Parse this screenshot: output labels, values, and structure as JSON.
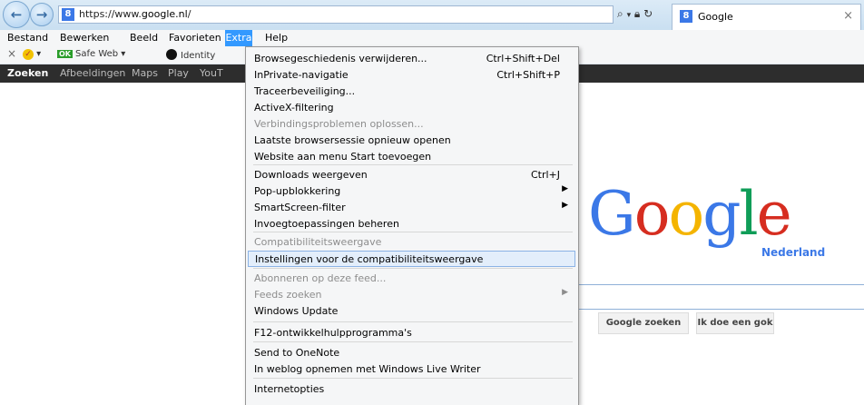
{
  "browser": {
    "url_prefix": "https://www.",
    "url_domain": "google.nl",
    "url_suffix": "/",
    "tab_title": "Google",
    "tab_close": "×"
  },
  "menubar": [
    "Bestand",
    "Bewerken",
    "Beeld",
    "Favorieten",
    "Extra",
    "Help"
  ],
  "toolbar": {
    "close": "×",
    "safe_web": "Safe Web ▾",
    "ok": "OK",
    "identity": "Identity"
  },
  "google_bar": [
    "Zoeken",
    "Afbeeldingen",
    "Maps",
    "Play",
    "YouT"
  ],
  "extra_menu": [
    {
      "label": "Browsegeschiedenis verwijderen...",
      "shortcut": "Ctrl+Shift+Del"
    },
    {
      "label": "InPrivate-navigatie",
      "shortcut": "Ctrl+Shift+P"
    },
    {
      "label": "Traceerbeveiliging..."
    },
    {
      "label": "ActiveX-filtering"
    },
    {
      "label": "Verbindingsproblemen oplossen...",
      "disabled": true
    },
    {
      "label": "Laatste browsersessie opnieuw openen"
    },
    {
      "label": "Website aan menu Start toevoegen"
    },
    {
      "label": "Downloads weergeven",
      "shortcut": "Ctrl+J"
    },
    {
      "label": "Pop-upblokkering",
      "submenu": true
    },
    {
      "label": "SmartScreen-filter",
      "submenu": true
    },
    {
      "label": "Invoegtoepassingen beheren"
    },
    {
      "label": "Compatibiliteitsweergave",
      "disabled": true
    },
    {
      "label": "Instellingen voor de compatibiliteitsweergave",
      "highlighted": true
    },
    {
      "label": "Abonneren op deze feed...",
      "disabled": true
    },
    {
      "label": "Feeds zoeken",
      "disabled": true,
      "submenu": true
    },
    {
      "label": "Windows Update"
    },
    {
      "label": "F12-ontwikkelhulpprogramma's"
    },
    {
      "label": "Send to OneNote"
    },
    {
      "label": "In weblog opnemen met Windows Live Writer"
    },
    {
      "label": "Internetopties"
    }
  ],
  "google": {
    "logo_letters": [
      "G",
      "o",
      "o",
      "g",
      "l",
      "e"
    ],
    "logo_colors": [
      "#3b78e7",
      "#d62d20",
      "#f4b400",
      "#3b78e7",
      "#109d58",
      "#d62d20"
    ],
    "logo_sub": "Nederland",
    "search_button": "Google zoeken",
    "lucky_button": "Ik doe een gok"
  }
}
